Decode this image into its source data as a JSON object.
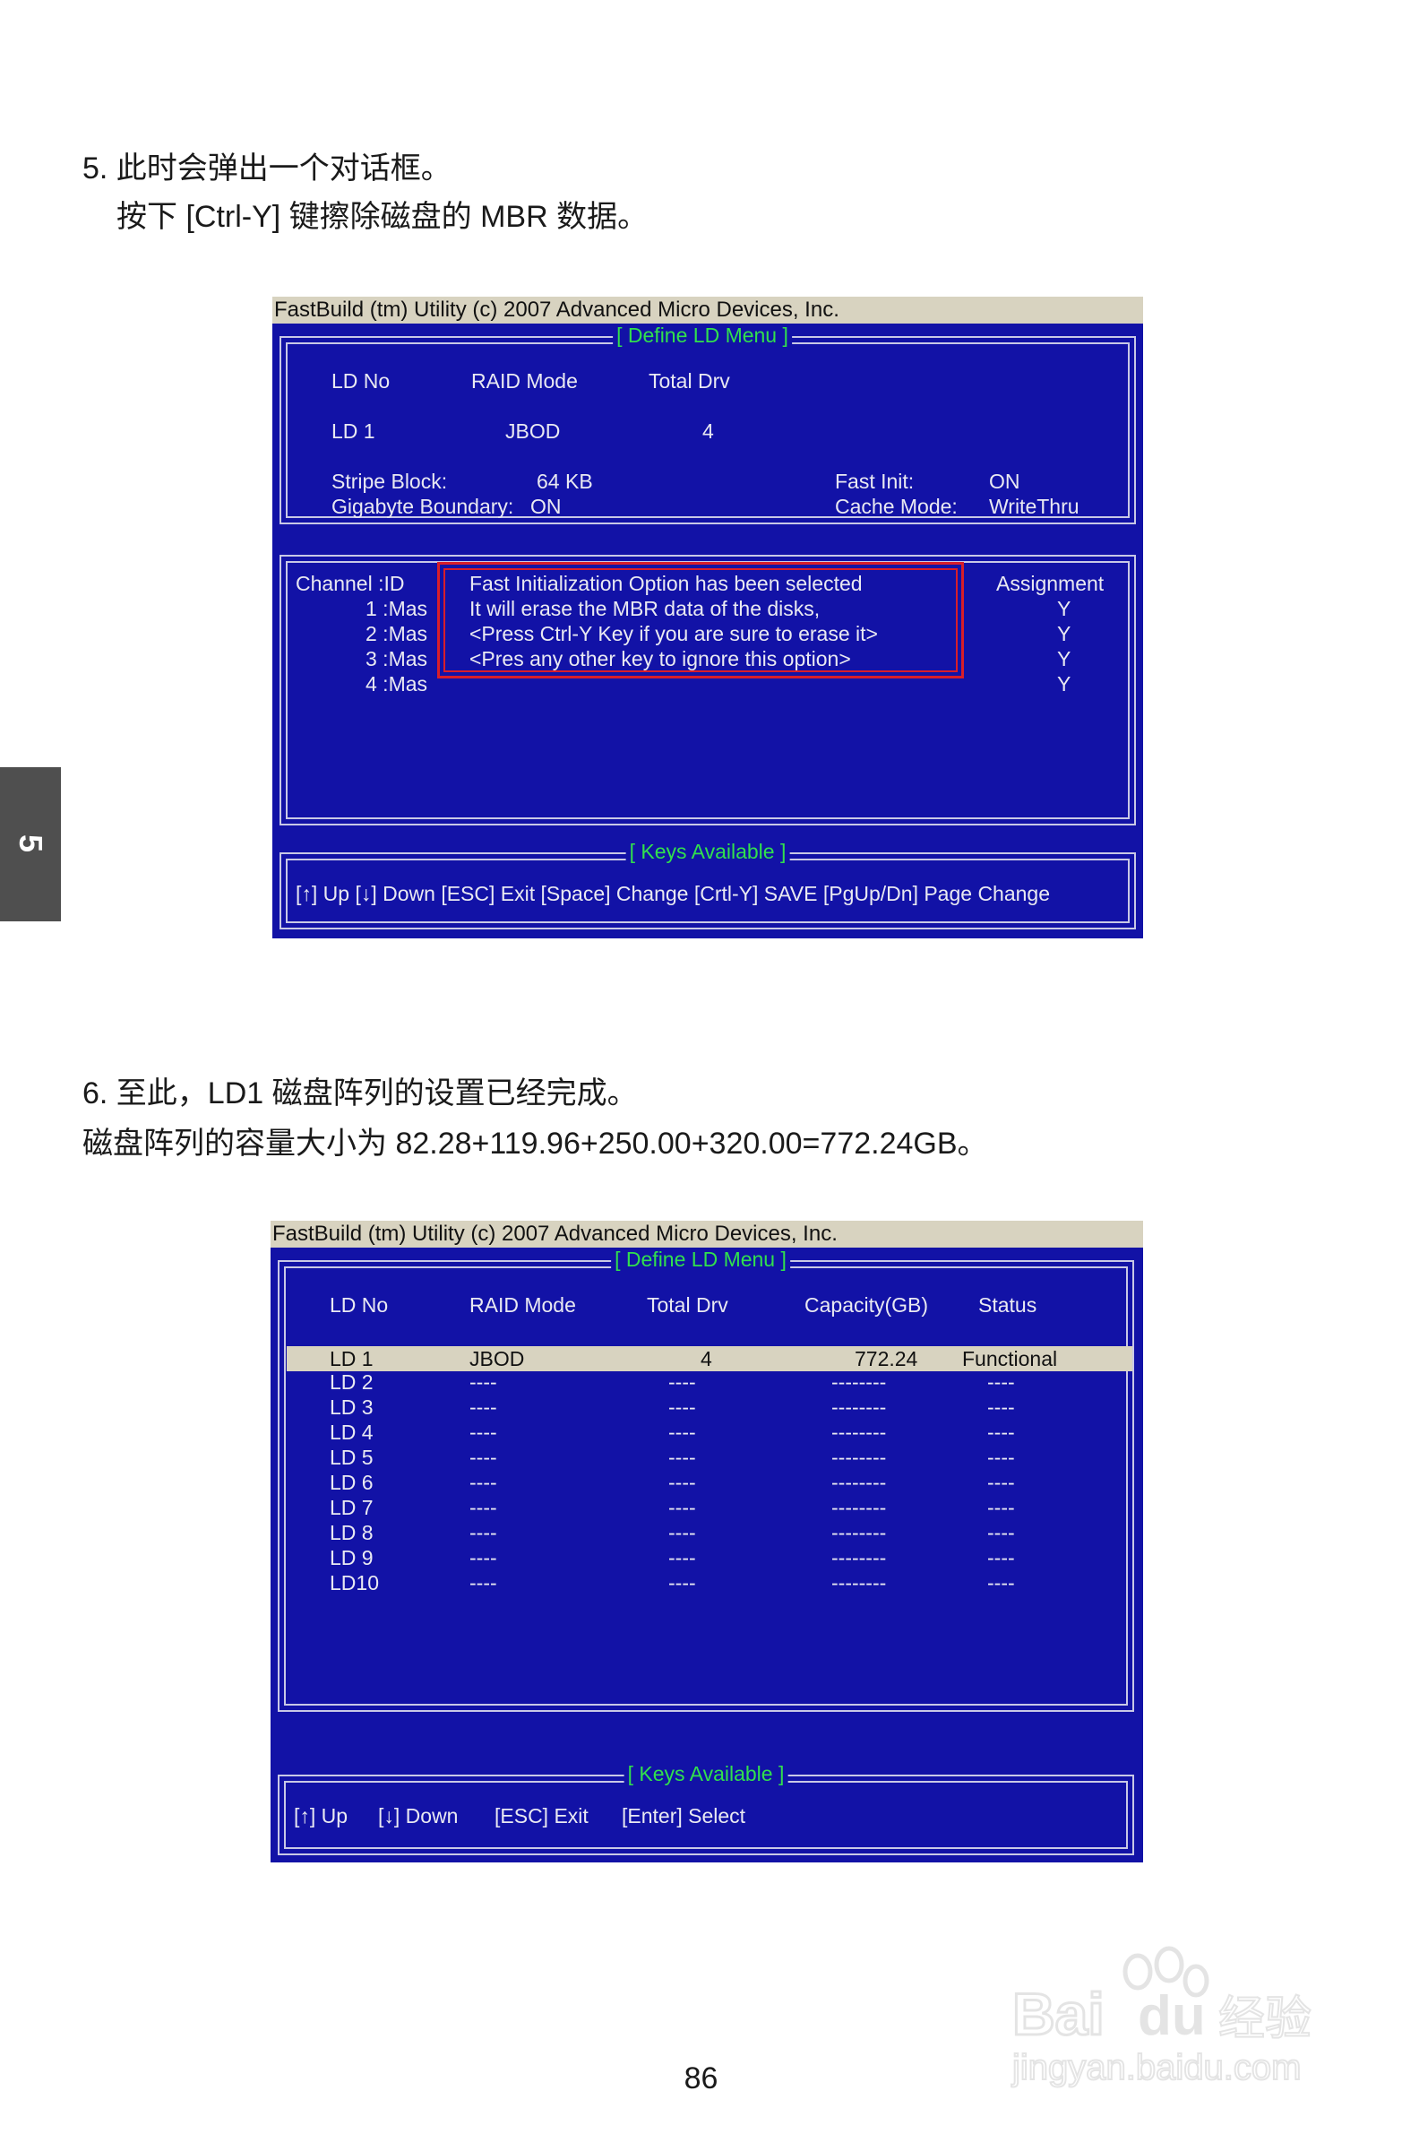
{
  "side_tab": {
    "label": "5"
  },
  "step5": {
    "line1": "5. 此时会弹出一个对话框。",
    "line2": "按下  [Ctrl-Y] 键擦除磁盘的  MBR 数据。"
  },
  "screen1": {
    "header": "FastBuild (tm) Utility (c) 2007 Advanced Micro Devices, Inc.",
    "menu_title": "[ Define LD Menu ]",
    "col_ld_no": "LD No",
    "col_raid_mode": "RAID Mode",
    "col_total_drv": "Total Drv",
    "ld_no": "LD  1",
    "raid_mode": "JBOD",
    "total_drv": "4",
    "stripe_label": "Stripe Block:",
    "stripe_value": "64   KB",
    "gigabyte_label": "Gigabyte Boundary:",
    "gigabyte_value": "ON",
    "fast_init_label": "Fast Init:",
    "fast_init_value": "ON",
    "cache_label": "Cache Mode:",
    "cache_value": "WriteThru",
    "channel_header": "Channel  :ID",
    "channels": [
      "1 :Mas",
      "2 :Mas",
      "3 :Mas",
      "4 :Mas"
    ],
    "assignment_header": "Assignment",
    "assignments": [
      "Y",
      "Y",
      "Y",
      "Y"
    ],
    "dialog_lines": [
      "Fast Initialization Option has been selected",
      "It will erase the MBR data of the disks,",
      "<Press Ctrl-Y Key if you are sure to erase it>",
      "<Pres any other key to ignore this option>"
    ],
    "keys_title": "[ Keys Available ]",
    "keys": "[↑] Up  [↓] Down  [ESC] Exit  [Space] Change  [Crtl-Y] SAVE   [PgUp/Dn] Page Change"
  },
  "step6": {
    "line1": "6.  至此，LD1 磁盘阵列的设置已经完成。",
    "line2": "磁盘阵列的容量大小为  82.28+119.96+250.00+320.00=772.24GB。"
  },
  "screen2": {
    "header": "FastBuild (tm) Utility (c) 2007 Advanced Micro Devices, Inc.",
    "menu_title": "[ Define LD Menu ]",
    "columns": [
      "LD No",
      "RAID Mode",
      "Total Drv",
      "Capacity(GB)",
      "Status"
    ],
    "rows": [
      [
        "LD  1",
        "JBOD",
        "4",
        "772.24",
        "Functional"
      ],
      [
        "LD  2",
        "----",
        "----",
        "--------",
        "----"
      ],
      [
        "LD  3",
        "----",
        "----",
        "--------",
        "----"
      ],
      [
        "LD  4",
        "----",
        "----",
        "--------",
        "----"
      ],
      [
        "LD  5",
        "----",
        "----",
        "--------",
        "----"
      ],
      [
        "LD  6",
        "----",
        "----",
        "--------",
        "----"
      ],
      [
        "LD  7",
        "----",
        "----",
        "--------",
        "----"
      ],
      [
        "LD  8",
        "----",
        "----",
        "--------",
        "----"
      ],
      [
        "LD  9",
        "----",
        "----",
        "--------",
        "----"
      ],
      [
        "LD10",
        "----",
        "----",
        "--------",
        "----"
      ]
    ],
    "keys_title": "[ Keys Available ]",
    "keys": [
      "[↑] Up",
      "[↓] Down",
      "[ESC] Exit",
      "[Enter] Select"
    ]
  },
  "page_number": "86",
  "watermark": {
    "brand": "Bai du 经验",
    "url": "jingyan.baidu.com"
  }
}
